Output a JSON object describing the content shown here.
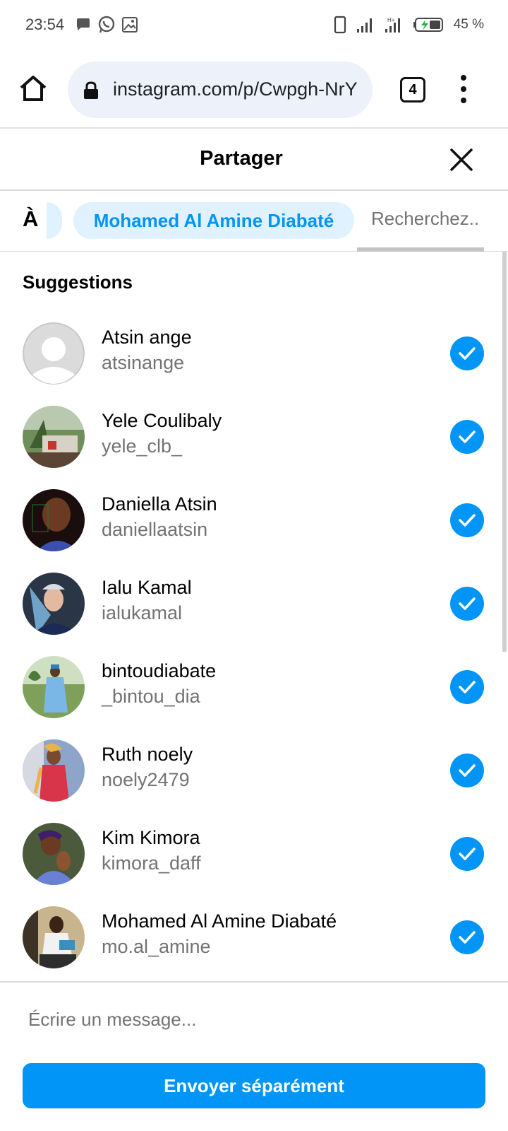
{
  "status_bar": {
    "time": "23:54",
    "battery": "45 %",
    "icons": [
      "message-icon",
      "whatsapp-icon",
      "gallery-icon",
      "vibrate-icon",
      "signal-icon",
      "signal-4g-icon",
      "battery-charging-icon"
    ]
  },
  "browser": {
    "url": "instagram.com/p/Cwpgh-NrY",
    "tab_count": "4"
  },
  "share": {
    "title": "Partager",
    "to_label": "À :",
    "selected_chip": "Mohamed Al Amine Diabaté",
    "search_placeholder": "Recherchez..",
    "suggestions_title": "Suggestions"
  },
  "suggestions": [
    {
      "name": "Atsin ange",
      "handle": "atsinange",
      "checked": true,
      "avatar": "default"
    },
    {
      "name": "Yele Coulibaly",
      "handle": "yele_clb_",
      "checked": true,
      "avatar": "photo"
    },
    {
      "name": "Daniella Atsin",
      "handle": "daniellaatsin",
      "checked": true,
      "avatar": "photo"
    },
    {
      "name": "Ialu Kamal",
      "handle": "ialukamal",
      "checked": true,
      "avatar": "photo"
    },
    {
      "name": "bintoudiabate",
      "handle": "_bintou_dia",
      "checked": true,
      "avatar": "photo"
    },
    {
      "name": "Ruth noely",
      "handle": "noely2479",
      "checked": true,
      "avatar": "photo"
    },
    {
      "name": "Kim Kimora",
      "handle": "kimora_daff",
      "checked": true,
      "avatar": "photo"
    },
    {
      "name": "Mohamed Al Amine Diabaté",
      "handle": "mo.al_amine",
      "checked": true,
      "avatar": "photo"
    }
  ],
  "footer": {
    "message_placeholder": "Écrire un message...",
    "send_label": "Envoyer séparément"
  },
  "colors": {
    "accent": "#0095f6",
    "chip_bg": "#e0f1ff",
    "secondary_text": "#737373"
  }
}
